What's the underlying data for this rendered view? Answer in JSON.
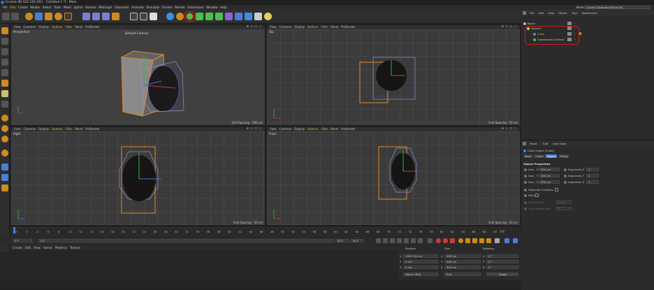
{
  "app": {
    "title": "Cinema 4D S22.116 (RC) - [Untitled 1 *] - Main",
    "accent": "#3b6fd4"
  },
  "menu": {
    "items": [
      "File",
      "Edit",
      "Create",
      "Modes",
      "Select",
      "Tools",
      "Mesh",
      "Spline",
      "Volume",
      "MoGraph",
      "Character",
      "Animate",
      "Simulate",
      "Tracker",
      "Render",
      "Extensions",
      "Window",
      "Help"
    ],
    "node_space_label": "Node Space:",
    "node_space_value": "Current (Standard/Physical)"
  },
  "viewports": {
    "menu": [
      "View",
      "Cameras",
      "Display",
      "Options",
      "Filter",
      "Panel",
      "ProRender"
    ],
    "perspective": {
      "name": "Perspective",
      "camera": "Default Camera",
      "grid": "Grid Spacing : 500 cm"
    },
    "top": {
      "name": "Top",
      "grid": "Grid Spacing : 50 cm"
    },
    "right": {
      "name": "Right",
      "grid": "Grid Spacing : 50 cm"
    },
    "front": {
      "name": "Front",
      "grid": "Grid Spacing : 50 cm"
    }
  },
  "timeline": {
    "ticks": [
      "0",
      "2",
      "4",
      "6",
      "8",
      "10",
      "12",
      "14",
      "16",
      "18",
      "20",
      "22",
      "24",
      "26",
      "28",
      "30",
      "32",
      "34",
      "36",
      "38",
      "40",
      "42",
      "44",
      "46",
      "48",
      "50",
      "52",
      "54",
      "56",
      "58",
      "60",
      "62",
      "64",
      "66",
      "68",
      "70",
      "72",
      "74",
      "76",
      "78",
      "80",
      "82",
      "84",
      "86",
      "88",
      "90"
    ],
    "end_label": "0 F",
    "start_field": "0 F",
    "current_field": "0 F",
    "max_field": "90 F",
    "max2_field": "90 F"
  },
  "materials": {
    "menu": [
      "Create",
      "Edit",
      "View",
      "Select",
      "Material",
      "Texture"
    ]
  },
  "coordinates": {
    "headers": [
      "Position",
      "Size",
      "Rotation"
    ],
    "rows": [
      {
        "axis": "X",
        "pos": "-159.702 cm",
        "size_axis": "X",
        "size": "200 cm",
        "rot_axis": "H",
        "rot": "0 °"
      },
      {
        "axis": "Y",
        "pos": "0 cm",
        "size_axis": "Y",
        "size": "400 cm",
        "rot_axis": "P",
        "rot": "0 °"
      },
      {
        "axis": "Z",
        "pos": "0 cm",
        "size_axis": "Z",
        "size": "200 cm",
        "rot_axis": "B",
        "rot": "0 °"
      }
    ],
    "mode": "Object (Rel)",
    "size_mode": "Size",
    "apply": "Apply"
  },
  "objects": {
    "menu": [
      "File",
      "Edit",
      "View",
      "Object",
      "Tags",
      "Bookmarks"
    ],
    "tree": [
      {
        "name": "Boole",
        "color": "#b7b7b7",
        "indent": 0
      },
      {
        "name": "Sphere",
        "color": "#d7d700",
        "indent": 1
      },
      {
        "name": "Cube",
        "color": "#d7d700",
        "indent": 2
      },
      {
        "name": "Subdivision Surface",
        "color": "#d7d700",
        "indent": 2
      }
    ]
  },
  "attributes": {
    "menu": [
      "Mode",
      "Edit",
      "User Data"
    ],
    "object_title": "Cube Object [Cube]",
    "tabs": [
      "Basic",
      "Coord.",
      "Object",
      "Phong"
    ],
    "active_tab": "Object",
    "section": "Object Properties",
    "size_rows": [
      {
        "label": "Size . X",
        "value": "200 cm",
        "seg_label": "Segments X",
        "seg": "1"
      },
      {
        "label": "Size . Y",
        "value": "400 cm",
        "seg_label": "Segments Y",
        "seg": "1"
      },
      {
        "label": "Size . Z",
        "value": "200 cm",
        "seg_label": "Segments Z",
        "seg": "1"
      }
    ],
    "separate": "Separate Surfaces",
    "fillet": "Fillet",
    "fillet_radius": "Fillet Radius",
    "fillet_radius_val": "1 cm",
    "fillet_sub": "Fillet Subdivision",
    "fillet_sub_val": "0"
  }
}
